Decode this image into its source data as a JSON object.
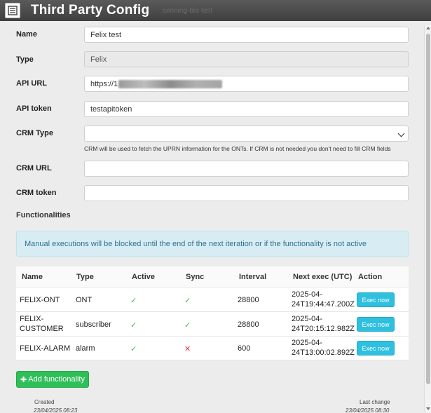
{
  "window": {
    "title": "Third Party Config",
    "ghost_text": "cenning-bla-test"
  },
  "form": {
    "name": {
      "label": "Name",
      "value": "Felix test"
    },
    "type": {
      "label": "Type",
      "value": "Felix"
    },
    "api_url": {
      "label": "API URL",
      "value": "https://1"
    },
    "api_token": {
      "label": "API token",
      "value": "testapitoken"
    },
    "crm_type": {
      "label": "CRM Type",
      "value": "",
      "hint": "CRM will be used to fetch the UPRN information for the ONTs. If CRM is not needed you don't need to fill CRM fields"
    },
    "crm_url": {
      "label": "CRM URL",
      "value": ""
    },
    "crm_token": {
      "label": "CRM token",
      "value": ""
    }
  },
  "functionalities": {
    "title": "Functionalities",
    "alert": "Manual executions will be blocked until the end of the next iteration or if the functionality is not active",
    "columns": [
      "Name",
      "Type",
      "Active",
      "Sync",
      "Interval",
      "Next exec (UTC)",
      "Action"
    ],
    "rows": [
      {
        "name": "FELIX-ONT",
        "type": "ONT",
        "active": "✓",
        "sync": "✓",
        "interval": "28800",
        "next_exec_1": "2025-04-",
        "next_exec_2": "24T19:44:47.200Z",
        "action": "Exec now"
      },
      {
        "name_1": "FELIX-",
        "name_2": "CUSTOMER",
        "type": "subscriber",
        "active": "✓",
        "sync": "✓",
        "interval": "28800",
        "next_exec_1": "2025-04-",
        "next_exec_2": "24T20:15:12.982Z",
        "action": "Exec now"
      },
      {
        "name": "FELIX-ALARM",
        "type": "alarm",
        "active": "✓",
        "sync": "✕",
        "interval": "600",
        "next_exec_1": "2025-04-",
        "next_exec_2": "24T13:00:02.892Z",
        "action": "Exec now"
      }
    ],
    "add_button": "Add functionality"
  },
  "footer": {
    "created_label": "Created",
    "created_value": "23/04/2025 08:23",
    "last_change_label": "Last change",
    "last_change_value": "23/04/2025 08:30"
  },
  "colors": {
    "title_bar": "#474747",
    "exec_button": "#2ec0de",
    "add_button": "#2fbf59",
    "alert_bg": "#d7edf3",
    "check": "#3cba54",
    "cross": "#e53935"
  },
  "icons": {
    "menu": "list-icon",
    "check": "check-icon",
    "cross": "cross-icon",
    "plus": "plus-icon",
    "select": "chevron-down-icon"
  }
}
